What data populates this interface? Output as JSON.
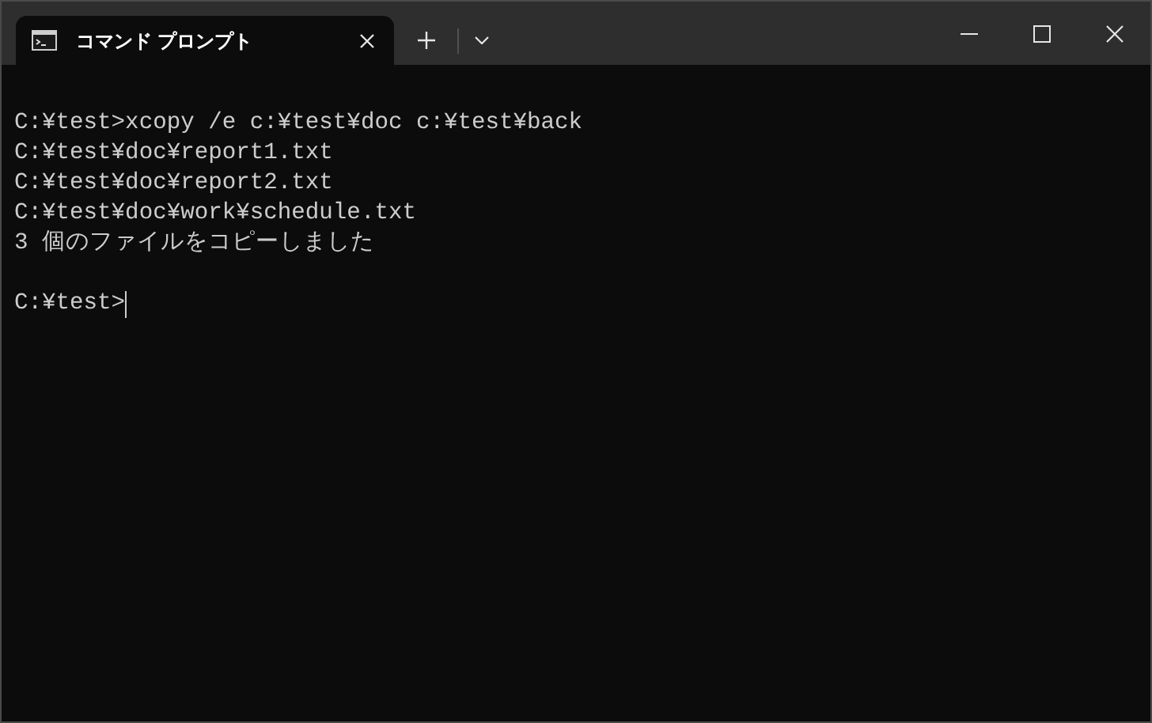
{
  "tab": {
    "title": "コマンド プロンプト",
    "selected": true
  },
  "terminal": {
    "output_lines": [
      "C:¥test>xcopy /e c:¥test¥doc c:¥test¥back",
      "C:¥test¥doc¥report1.txt",
      "C:¥test¥doc¥report2.txt",
      "C:¥test¥doc¥work¥schedule.txt",
      "3 個のファイルをコピーしました"
    ],
    "prompt": "C:¥test>"
  }
}
